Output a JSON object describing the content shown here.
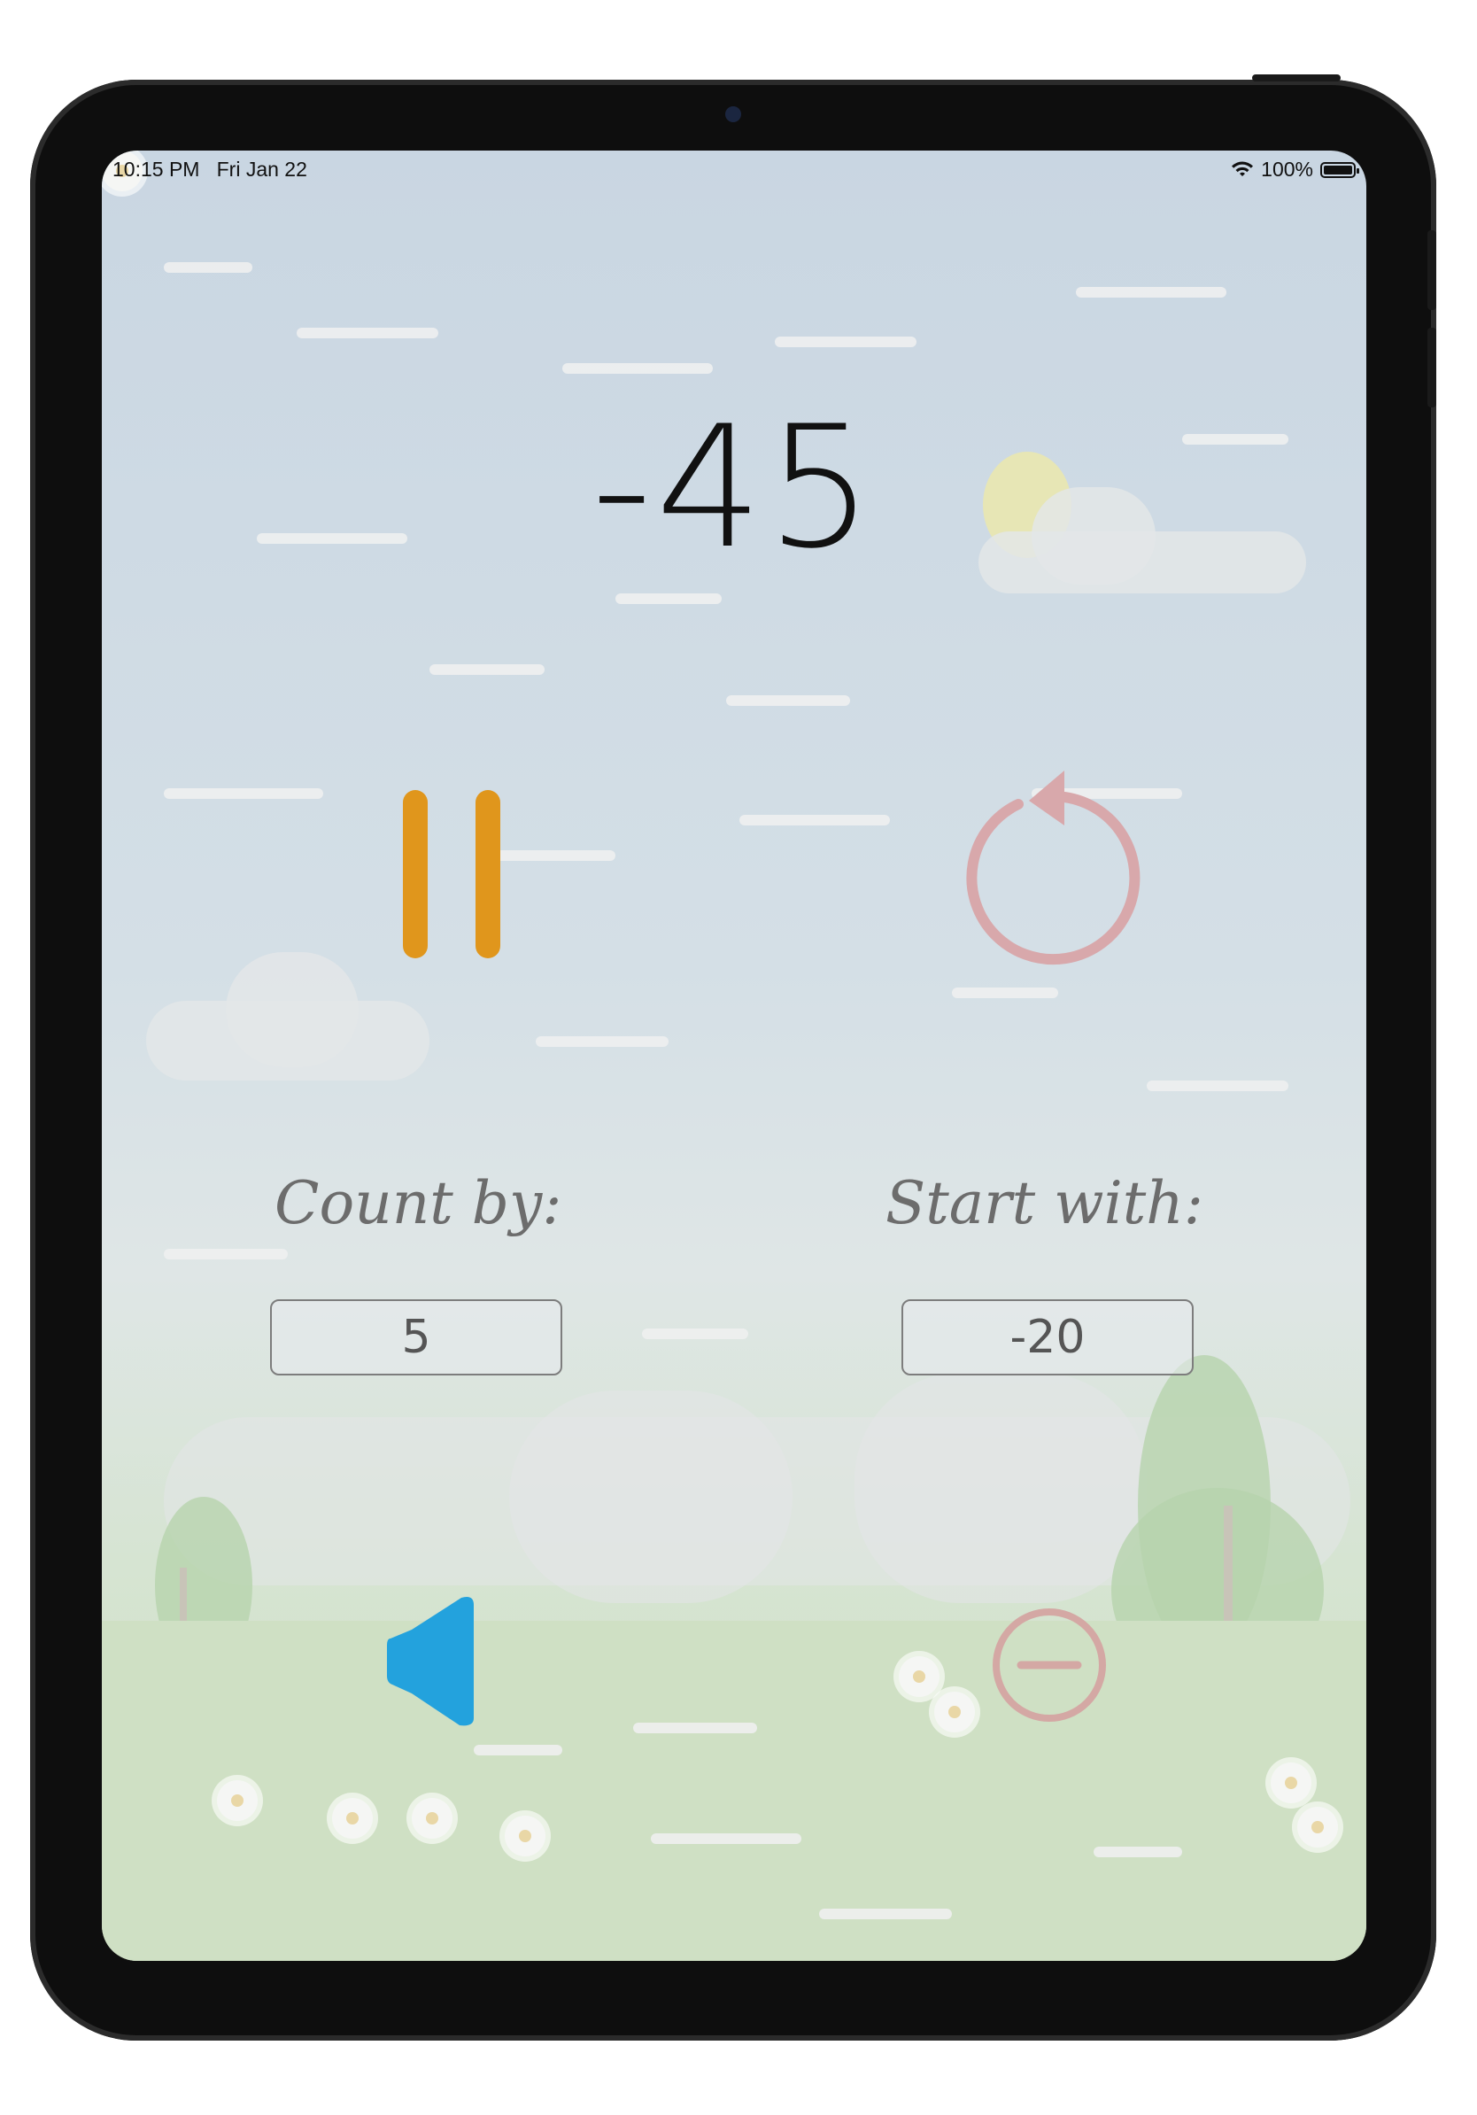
{
  "status_bar": {
    "time": "10:15 PM",
    "date": "Fri Jan 22",
    "battery": "100%"
  },
  "counter": {
    "value": "-45"
  },
  "controls": {
    "pause_icon": "pause-icon",
    "reset_icon": "restart-arrow-icon",
    "sound_icon": "speaker-icon",
    "minus_icon": "minus-circle-icon"
  },
  "settings": {
    "count_by_label": "Count by:",
    "count_by_value": "5",
    "start_with_label": "Start with:",
    "start_with_value": "-20"
  },
  "colors": {
    "pause": "#e0961c",
    "reset": "#d8a8ab",
    "speaker": "#23a2dd",
    "minus": "#d4a8a4"
  }
}
